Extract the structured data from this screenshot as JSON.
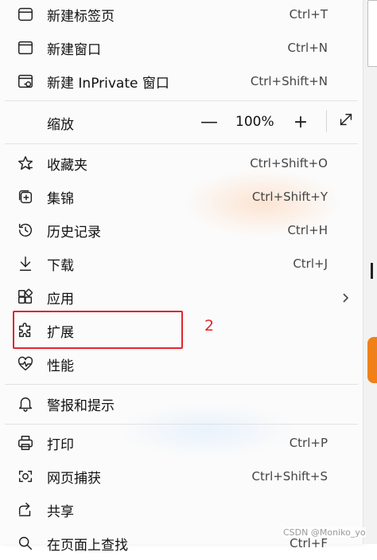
{
  "menu": {
    "items": [
      {
        "label": "新建标签页",
        "shortcut": "Ctrl+T",
        "icon": "new-tab-icon"
      },
      {
        "label": "新建窗口",
        "shortcut": "Ctrl+N",
        "icon": "new-window-icon"
      },
      {
        "label": "新建 InPrivate 窗口",
        "shortcut": "Ctrl+Shift+N",
        "icon": "inprivate-window-icon"
      },
      {
        "label": "收藏夹",
        "shortcut": "Ctrl+Shift+O",
        "icon": "favorites-icon"
      },
      {
        "label": "集锦",
        "shortcut": "Ctrl+Shift+Y",
        "icon": "collections-icon"
      },
      {
        "label": "历史记录",
        "shortcut": "Ctrl+H",
        "icon": "history-icon"
      },
      {
        "label": "下载",
        "shortcut": "Ctrl+J",
        "icon": "download-icon"
      },
      {
        "label": "应用",
        "shortcut": "",
        "icon": "apps-icon"
      },
      {
        "label": "扩展",
        "shortcut": "",
        "icon": "extensions-icon"
      },
      {
        "label": "性能",
        "shortcut": "",
        "icon": "performance-icon"
      },
      {
        "label": "警报和提示",
        "shortcut": "",
        "icon": "bell-icon"
      },
      {
        "label": "打印",
        "shortcut": "Ctrl+P",
        "icon": "print-icon"
      },
      {
        "label": "网页捕获",
        "shortcut": "Ctrl+Shift+S",
        "icon": "web-capture-icon"
      },
      {
        "label": "共享",
        "shortcut": "",
        "icon": "share-icon"
      },
      {
        "label": "在页面上查找",
        "shortcut": "Ctrl+F",
        "icon": "find-icon"
      }
    ],
    "zoom": {
      "label": "缩放",
      "minus": "—",
      "value": "100%",
      "plus": "+"
    }
  },
  "annotation": {
    "number": "2"
  },
  "watermark": "CSDN @Moniko_yo",
  "colors": {
    "highlight": "#e2262e",
    "accent_orange": "#f0801a"
  }
}
